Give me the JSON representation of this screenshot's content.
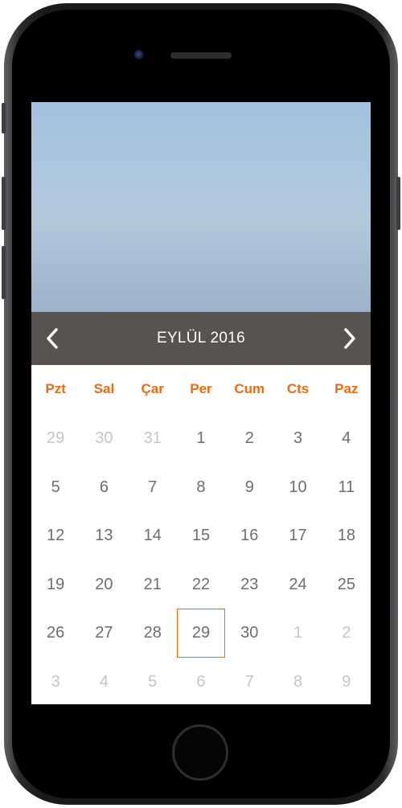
{
  "calendar": {
    "month_title": "EYLÜL 2016",
    "accent_color": "#f26a10",
    "header_color": "#585350",
    "prev_icon": "chevron-left-icon",
    "next_icon": "chevron-right-icon",
    "weekdays": [
      "Pzt",
      "Sal",
      "Çar",
      "Per",
      "Cum",
      "Cts",
      "Paz"
    ],
    "selected_day": "29",
    "weeks": [
      [
        {
          "d": "29",
          "other": true
        },
        {
          "d": "30",
          "other": true
        },
        {
          "d": "31",
          "other": true
        },
        {
          "d": "1",
          "other": false
        },
        {
          "d": "2",
          "other": false
        },
        {
          "d": "3",
          "other": false
        },
        {
          "d": "4",
          "other": false
        }
      ],
      [
        {
          "d": "5",
          "other": false
        },
        {
          "d": "6",
          "other": false
        },
        {
          "d": "7",
          "other": false
        },
        {
          "d": "8",
          "other": false
        },
        {
          "d": "9",
          "other": false
        },
        {
          "d": "10",
          "other": false
        },
        {
          "d": "11",
          "other": false
        }
      ],
      [
        {
          "d": "12",
          "other": false
        },
        {
          "d": "13",
          "other": false
        },
        {
          "d": "14",
          "other": false
        },
        {
          "d": "15",
          "other": false
        },
        {
          "d": "16",
          "other": false
        },
        {
          "d": "17",
          "other": false
        },
        {
          "d": "18",
          "other": false
        }
      ],
      [
        {
          "d": "19",
          "other": false
        },
        {
          "d": "20",
          "other": false
        },
        {
          "d": "21",
          "other": false
        },
        {
          "d": "22",
          "other": false
        },
        {
          "d": "23",
          "other": false
        },
        {
          "d": "24",
          "other": false
        },
        {
          "d": "25",
          "other": false
        }
      ],
      [
        {
          "d": "26",
          "other": false
        },
        {
          "d": "27",
          "other": false
        },
        {
          "d": "28",
          "other": false
        },
        {
          "d": "29",
          "other": false,
          "selected": true
        },
        {
          "d": "30",
          "other": false
        },
        {
          "d": "1",
          "other": true
        },
        {
          "d": "2",
          "other": true
        }
      ],
      [
        {
          "d": "3",
          "other": true
        },
        {
          "d": "4",
          "other": true
        },
        {
          "d": "5",
          "other": true
        },
        {
          "d": "6",
          "other": true
        },
        {
          "d": "7",
          "other": true
        },
        {
          "d": "8",
          "other": true
        },
        {
          "d": "9",
          "other": true
        }
      ]
    ]
  }
}
